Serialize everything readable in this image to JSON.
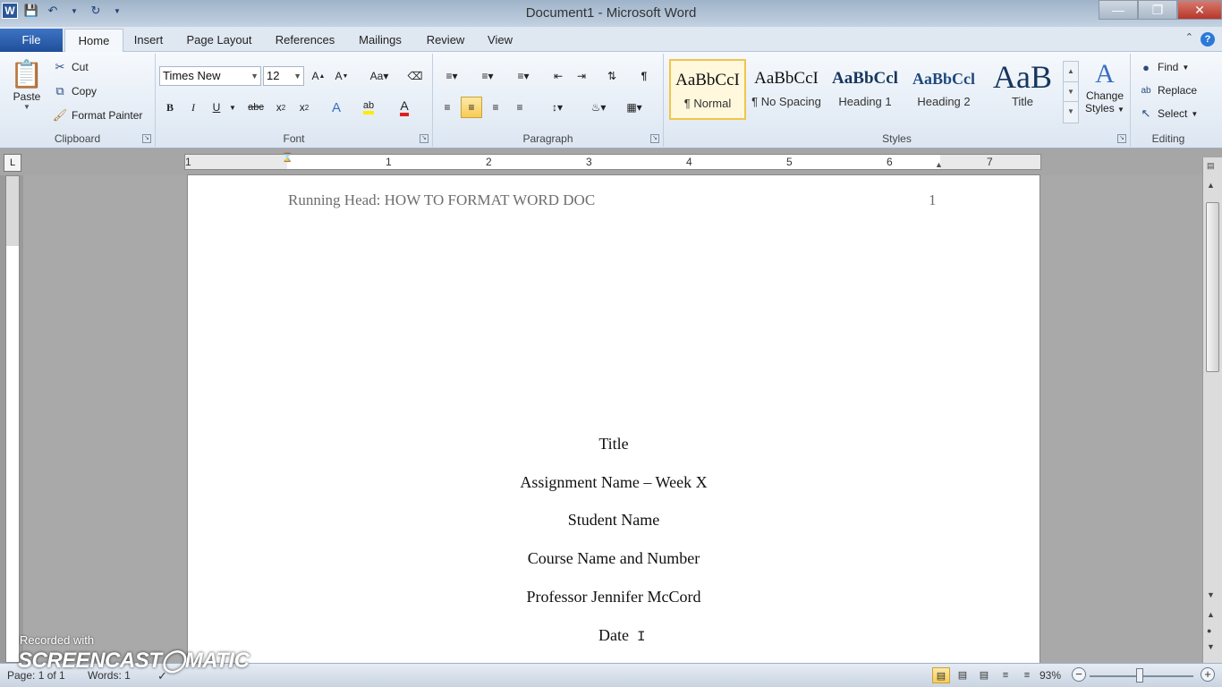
{
  "window": {
    "title": "Document1  -  Microsoft Word",
    "app_icon_letter": "W"
  },
  "tabs": [
    {
      "label": "File"
    },
    {
      "label": "Home"
    },
    {
      "label": "Insert"
    },
    {
      "label": "Page Layout"
    },
    {
      "label": "References"
    },
    {
      "label": "Mailings"
    },
    {
      "label": "Review"
    },
    {
      "label": "View"
    }
  ],
  "ribbon": {
    "clipboard": {
      "label": "Clipboard",
      "paste": "Paste",
      "cut": "Cut",
      "copy": "Copy",
      "format_painter": "Format Painter"
    },
    "font": {
      "label": "Font",
      "font_name": "Times New Roman",
      "font_size": "12"
    },
    "paragraph": {
      "label": "Paragraph"
    },
    "styles": {
      "label": "Styles",
      "items": [
        {
          "preview": "AaBbCcI",
          "name": "¶ Normal"
        },
        {
          "preview": "AaBbCcI",
          "name": "¶ No Spacing"
        },
        {
          "preview": "AaBbCcl",
          "name": "Heading 1"
        },
        {
          "preview": "AaBbCcl",
          "name": "Heading 2"
        },
        {
          "preview": "AaB",
          "name": "Title"
        }
      ],
      "change_styles_line1": "Change",
      "change_styles_line2": "Styles"
    },
    "editing": {
      "label": "Editing",
      "find": "Find",
      "replace": "Replace",
      "select": "Select"
    }
  },
  "ruler": {
    "tab_selector": "L",
    "numbers": [
      "1",
      "1",
      "2",
      "3",
      "4",
      "5",
      "6",
      "7"
    ]
  },
  "document": {
    "running_head": "Running Head: HOW TO FORMAT WORD DOC",
    "page_number": "1",
    "title_lines": [
      "Title",
      "Assignment Name – Week X",
      "Student Name",
      "Course Name and Number",
      "Professor Jennifer McCord",
      "Date"
    ]
  },
  "status": {
    "page": "Page: 1 of 1",
    "words": "Words: 1",
    "zoom": "93%"
  },
  "watermark": {
    "line1": "Recorded with",
    "line2": "SCREENCAST◯MATIC"
  }
}
